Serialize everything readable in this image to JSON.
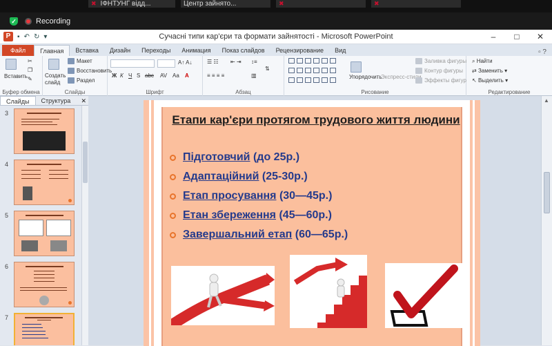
{
  "meeting": {
    "tiles": [
      "ІФНТУНГ відд...",
      "Центр зайнято...",
      "",
      ""
    ],
    "recording_label": "Recording"
  },
  "window": {
    "title": "Сучасні типи кар'єри та формати зайнятості  -  Microsoft PowerPoint",
    "buttons": [
      "–",
      "□",
      "✕"
    ]
  },
  "ribbon_tabs": [
    "Файл",
    "Главная",
    "Вставка",
    "Дизайн",
    "Переходы",
    "Анимация",
    "Показ слайдов",
    "Рецензирование",
    "Вид"
  ],
  "ribbon": {
    "clipboard": {
      "paste": "Вставить",
      "label": "Буфер обмена"
    },
    "slides": {
      "new_slide": "Создать слайд",
      "layout": "Макет",
      "reset": "Восстановить",
      "section": "Раздел",
      "label": "Слайды"
    },
    "font": {
      "label": "Шрифт"
    },
    "paragraph": {
      "label": "Абзац"
    },
    "drawing": {
      "arrange": "Упорядочить",
      "quick_styles": "Экспресс-стили",
      "fill": "Заливка фигуры",
      "outline": "Контур фигуры",
      "effects": "Эффекты фигур",
      "label": "Рисование"
    },
    "editing": {
      "find": "Найти",
      "replace": "Заменить",
      "select": "Выделить",
      "label": "Редактирование"
    }
  },
  "panel": {
    "tabs": [
      "Слайды",
      "Структура"
    ],
    "thumbnails": [
      {
        "num": "3",
        "title": "Висхідний тип кар'єри"
      },
      {
        "num": "4",
        "title": "ВЕРТИКАЛЬНИЙ ТИП КАР'ЄРИ"
      },
      {
        "num": "5",
        "title": "Горизонтальний тип кар'єри"
      },
      {
        "num": "6",
        "title": "Низхідна (регресивна) кар'єра"
      },
      {
        "num": "7",
        "title": "Етапи кар'єри протягом трудового життя людини"
      }
    ]
  },
  "slide": {
    "title": "Етапи кар'єри протягом трудового життя людини",
    "bullets": [
      {
        "name": "Підготовчий",
        "range": "(до 25р.)"
      },
      {
        "name": "Адаптаційний",
        "range": "(25-30р.)"
      },
      {
        "name": "Етап просування",
        "range": "(30—45р.)"
      },
      {
        "name": "Етан збереження",
        "range": "(45—60р.)"
      },
      {
        "name": "Завершальний етап",
        "range": "(60—65р.)"
      }
    ]
  },
  "colors": {
    "accent": "#d24726",
    "slide_bg": "#fbbf9d",
    "bullet_text": "#243a8c",
    "bullet_mark": "#e8742c"
  }
}
